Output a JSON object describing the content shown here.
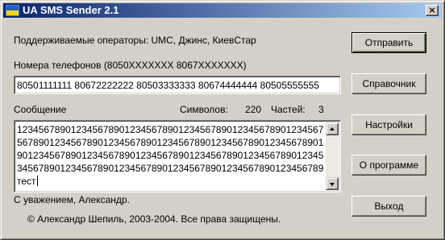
{
  "window": {
    "title": "UA SMS Sender 2.1",
    "icon": "ukraine-flag-icon",
    "close_glyph": "×"
  },
  "operators_text": "Поддерживаемые операторы: UMC, Джинс, КиевСтар",
  "phones": {
    "label": "Номера телефонов (8050XXXXXXX 8067XXXXXXX)",
    "value": "80501111111 80672222222 80503333333 80674444444 80505555555"
  },
  "message": {
    "label": "Сообщение",
    "chars_label": "Символов:",
    "chars_count": "220",
    "parts_label": "Частей:",
    "parts_count": "3",
    "lines": [
      "1234567890123456789012345678901234567890123456789012345678901234",
      "5678901234567890123456789012345678901234567890123456789012345678",
      "9012345678901234567890123456789012345678901234567890123456789012",
      "3456789012345678901234567890123456789012345678901234567890123456",
      "тест"
    ]
  },
  "signature": "С уважением, Александр.",
  "copyright": "© Александр Шепиль, 2003-2004. Все права защищены.",
  "buttons": {
    "send": "Отправить",
    "directory": "Справочник",
    "settings": "Настройки",
    "about": "О программе",
    "exit": "Выход"
  }
}
